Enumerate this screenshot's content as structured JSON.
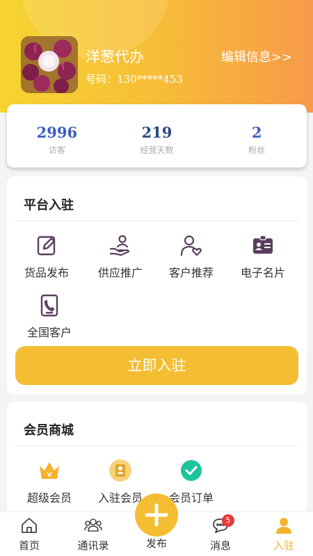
{
  "profile": {
    "name": "洋葱代办",
    "phone": "号码：130*****453",
    "edit_label": "编辑信息>>"
  },
  "stats": [
    {
      "value": "2996",
      "label": "访客"
    },
    {
      "value": "219",
      "label": "经营天数"
    },
    {
      "value": "2",
      "label": "粉丝"
    }
  ],
  "platform": {
    "title": "平台入驻",
    "items": [
      {
        "label": "货品发布",
        "icon": "edit-icon"
      },
      {
        "label": "供应推广",
        "icon": "hand-person-icon"
      },
      {
        "label": "客户推荐",
        "icon": "user-heart-icon"
      },
      {
        "label": "电子名片",
        "icon": "id-card-icon"
      },
      {
        "label": "全国客户",
        "icon": "phone-contact-icon"
      }
    ],
    "join_button": "立即入驻"
  },
  "member": {
    "title": "会员商城",
    "items": [
      {
        "label": "超级会员",
        "icon": "crown-icon"
      },
      {
        "label": "入驻会员",
        "icon": "member-badge-icon"
      },
      {
        "label": "会员订单",
        "icon": "check-circle-icon"
      }
    ]
  },
  "tabbar": {
    "items": [
      {
        "label": "首页",
        "icon": "home-icon"
      },
      {
        "label": "通讯录",
        "icon": "contacts-icon"
      },
      {
        "label": "发布",
        "icon": "plus-icon"
      },
      {
        "label": "消息",
        "icon": "message-icon",
        "badge": "5"
      },
      {
        "label": "入驻",
        "icon": "person-icon"
      }
    ],
    "active": "入驻"
  },
  "colors": {
    "accent": "#f4bd32",
    "icon_purple": "#5a3e5e",
    "stat_blue": "#3b5fbd",
    "badge_red": "#e53935"
  }
}
